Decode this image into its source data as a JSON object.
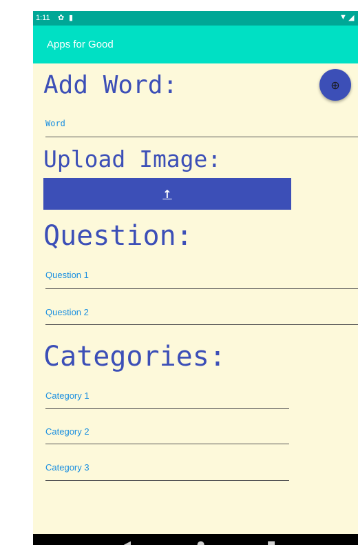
{
  "status_bar": {
    "time": "1:11",
    "left_icons": [
      "gear-icon",
      "battery-saver-icon"
    ],
    "right_icons": [
      "wifi-icon",
      "signal-icon"
    ]
  },
  "app_bar": {
    "title": "Apps for Good",
    "color": "#00e0c4"
  },
  "form": {
    "add_word_heading": "Add Word:",
    "word_field": {
      "label": "Word"
    },
    "upload_heading": "Upload Image:",
    "upload_button": {
      "icon": "upload-icon",
      "glyph": "↑"
    },
    "question_heading": "Question:",
    "questions": [
      {
        "label": "Question 1"
      },
      {
        "label": "Question 2"
      }
    ],
    "categories_heading": "Categories:",
    "categories": [
      {
        "label": "Category 1"
      },
      {
        "label": "Category 2"
      },
      {
        "label": "Category 3"
      }
    ]
  },
  "fab": {
    "icon": "add-circle-icon",
    "glyph": "⊕",
    "color": "#3c4fb7"
  },
  "nav_bar": {
    "buttons": [
      "back-icon",
      "home-icon",
      "recents-icon"
    ]
  },
  "colors": {
    "background": "#fdf9da",
    "heading": "#3c4fb7",
    "label": "#1a8fe0",
    "status_bar": "#00a796"
  }
}
